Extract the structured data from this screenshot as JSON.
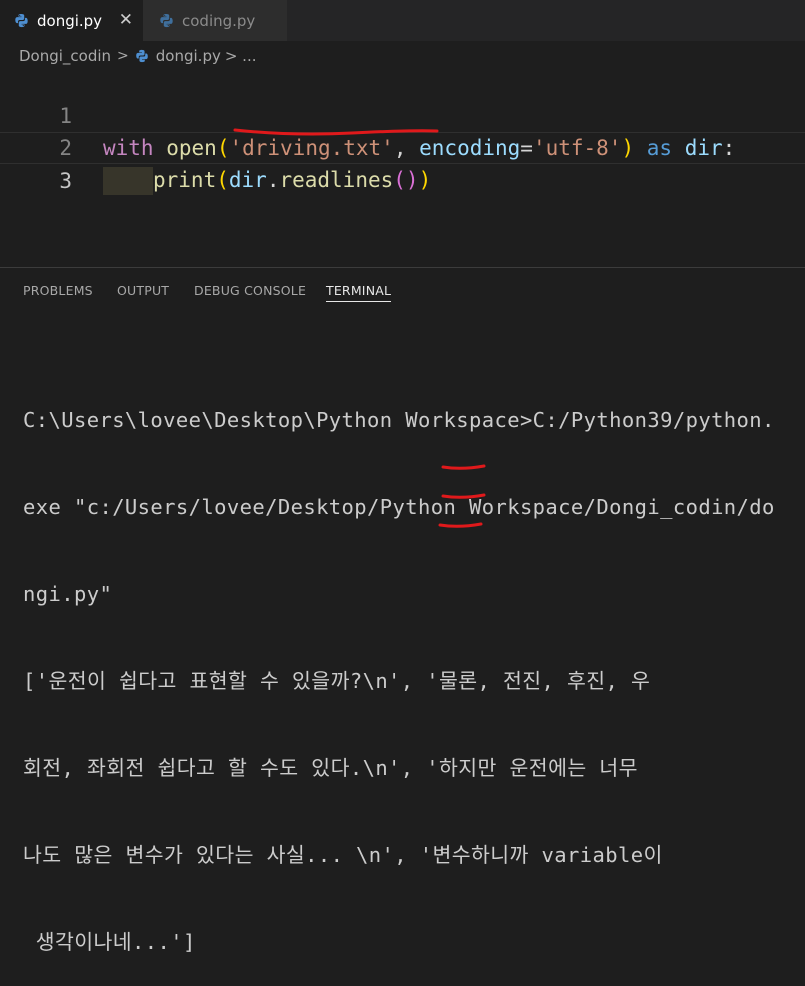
{
  "tabs": [
    {
      "label": "dongi.py",
      "close": "✕"
    },
    {
      "label": "coding.py"
    }
  ],
  "breadcrumb": {
    "folder": "Dongi_codin",
    "sep": ">",
    "file": "dongi.py",
    "more": "> ..."
  },
  "editor": {
    "line_numbers": [
      "1",
      "2",
      "3"
    ],
    "line1": {
      "kw_with": "with",
      "fn_open": "open",
      "paren_open": "(",
      "str1": "'driving.txt'",
      "comma": ", ",
      "param": "encoding",
      "eq": "=",
      "str2": "'utf-8'",
      "paren_close": ")",
      "as_kw": " as ",
      "var": "dir",
      "colon": ":"
    },
    "line2": {
      "fn_print": "print",
      "paren_open": "(",
      "var": "dir",
      "dot": ".",
      "method": "readlines",
      "inner_open": "(",
      "inner_close": ")",
      "paren_close": ")"
    }
  },
  "panel": {
    "tabs": [
      "PROBLEMS",
      "OUTPUT",
      "DEBUG CONSOLE",
      "TERMINAL"
    ],
    "active_tab": "TERMINAL"
  },
  "terminal": {
    "lines": [
      "C:\\Users\\lovee\\Desktop\\Python Workspace>C:/Python39/python.",
      "exe \"c:/Users/lovee/Desktop/Python Workspace/Dongi_codin/do",
      "ngi.py\"",
      "['운전이 쉽다고 표현할 수 있을까?\\n', '물론, 전진, 후진, 우",
      "회전, 좌회전 쉽다고 할 수도 있다.\\n', '하지만 운전에는 너무",
      "나도 많은 변수가 있다는 사실... \\n', '변수하니까 variable이",
      " 생각이나네...']"
    ]
  },
  "colors": {
    "annotation": "#e0191b",
    "python_icon": "#4e8fd1"
  }
}
